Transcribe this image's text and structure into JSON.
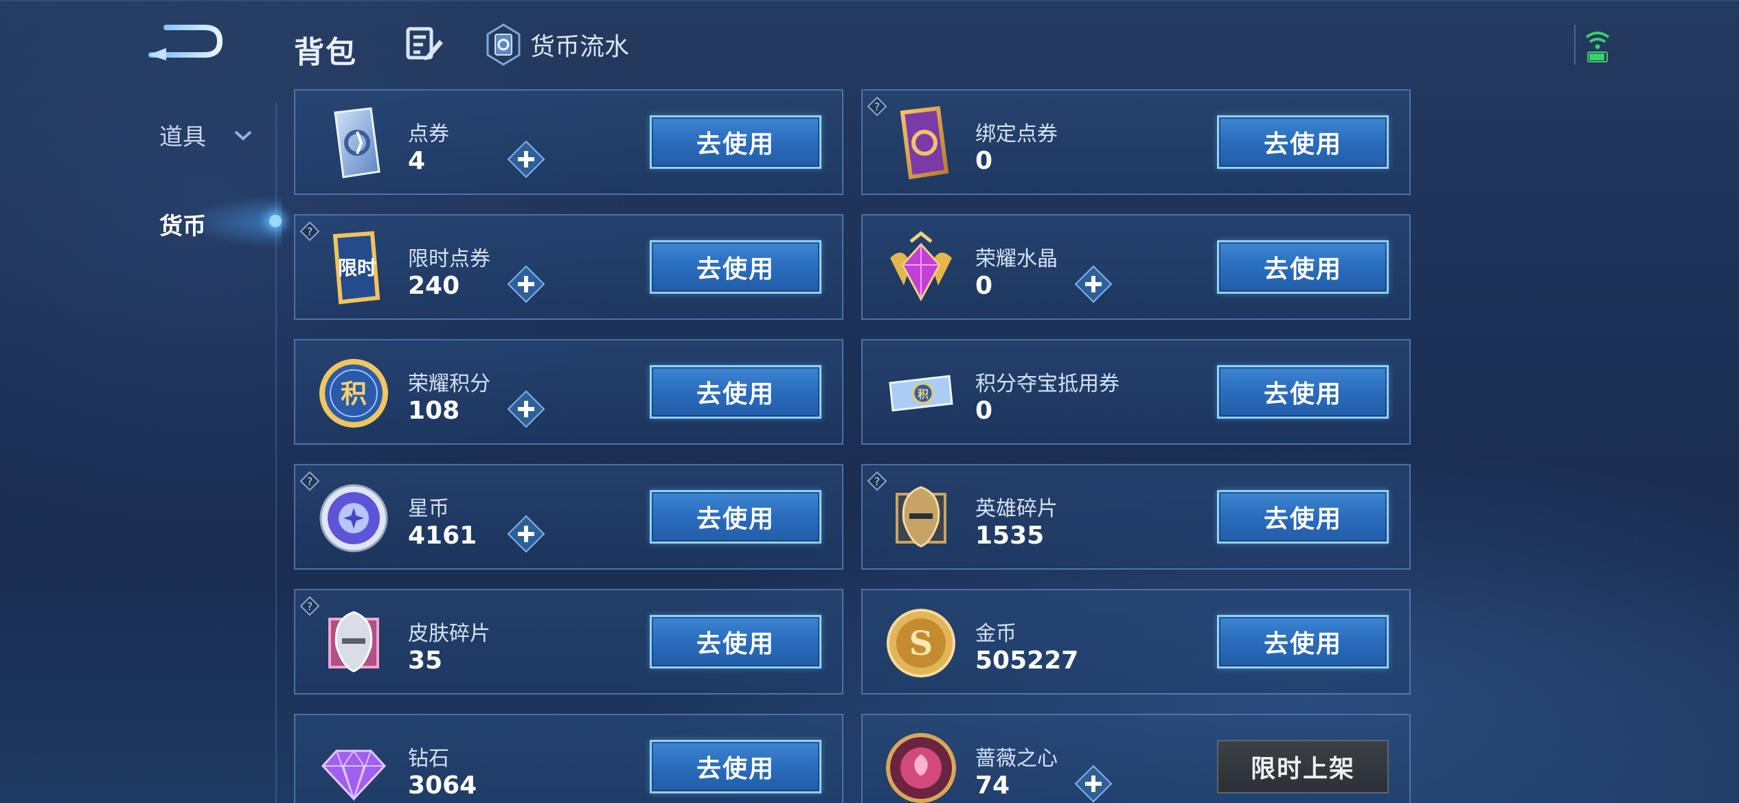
{
  "header": {
    "title": "背包",
    "flow_label": "货币流水"
  },
  "sidebar": {
    "items": [
      {
        "label": "道具"
      },
      {
        "label": "货币"
      }
    ]
  },
  "currencies": [
    {
      "name": "点券",
      "count": "4",
      "button": "去使用"
    },
    {
      "name": "绑定点券",
      "count": "0",
      "button": "去使用"
    },
    {
      "name": "限时点券",
      "count": "240",
      "button": "去使用"
    },
    {
      "name": "荣耀水晶",
      "count": "0",
      "button": "去使用"
    },
    {
      "name": "荣耀积分",
      "count": "108",
      "button": "去使用"
    },
    {
      "name": "积分夺宝抵用券",
      "count": "0",
      "button": "去使用"
    },
    {
      "name": "星币",
      "count": "4161",
      "button": "去使用"
    },
    {
      "name": "英雄碎片",
      "count": "1535",
      "button": "去使用"
    },
    {
      "name": "皮肤碎片",
      "count": "35",
      "button": "去使用"
    },
    {
      "name": "金币",
      "count": "505227",
      "button": "去使用"
    },
    {
      "name": "钻石",
      "count": "3064",
      "button": "去使用"
    },
    {
      "name": "蔷薇之心",
      "count": "74",
      "button": "限时上架"
    }
  ],
  "icon_labels": {
    "limited_ticket": "限时",
    "points_coin": "积",
    "voucher": "积",
    "gold_coin": "S"
  },
  "colors": {
    "button_blue": "#2a6cbd",
    "button_border": "#8fd2ff",
    "limited_button": "#3b4047",
    "wifi": "#3ad06a"
  }
}
